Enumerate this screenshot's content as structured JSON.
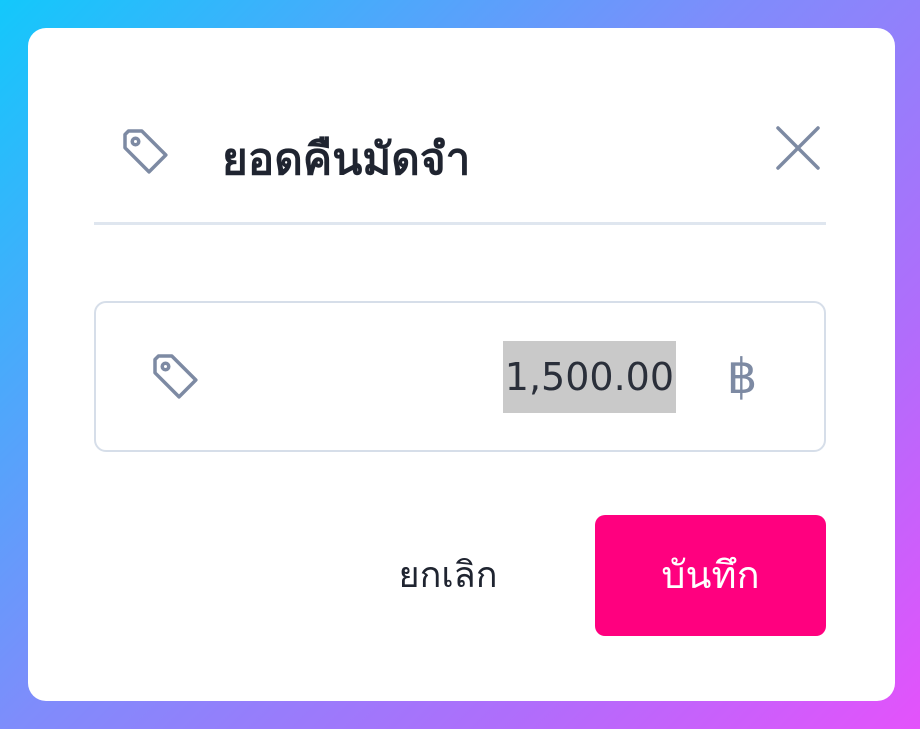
{
  "dialog": {
    "title": "ยอดคืนมัดจำ",
    "title_icon": "tag-icon",
    "close_icon": "close-icon"
  },
  "amount_field": {
    "icon": "tag-icon",
    "value": "1,500.00",
    "currency_symbol": "฿"
  },
  "actions": {
    "cancel_label": "ยกเลิก",
    "save_label": "บันทึก"
  },
  "colors": {
    "primary": "#ff007f",
    "divider": "#dfe6ef",
    "icon": "#7d8aa3"
  }
}
